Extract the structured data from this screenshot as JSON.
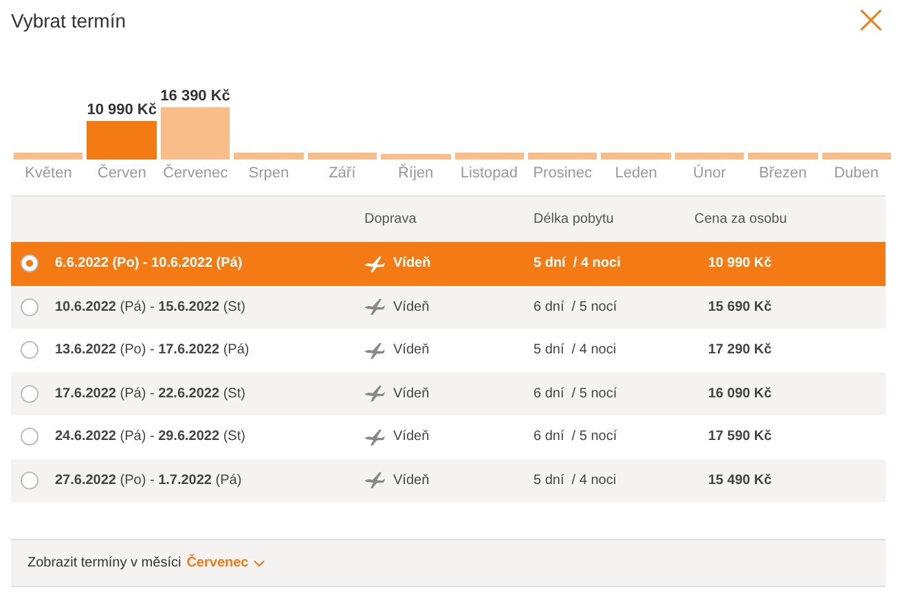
{
  "dialog": {
    "title": "Vybrat termín",
    "close": "×"
  },
  "months": [
    {
      "name": "Květen",
      "selected": false
    },
    {
      "name": "Červen",
      "selected": true,
      "price": "10 990 Kč"
    },
    {
      "name": "Červenec",
      "selected": false,
      "price": "16 390 Kč"
    },
    {
      "name": "Srpen",
      "selected": false
    },
    {
      "name": "Září",
      "selected": false
    },
    {
      "name": "Říjen",
      "selected": false
    },
    {
      "name": "Listopad",
      "selected": false
    },
    {
      "name": "Prosinec",
      "selected": false
    },
    {
      "name": "Leden",
      "selected": false
    },
    {
      "name": "Únor",
      "selected": false
    },
    {
      "name": "Březen",
      "selected": false
    },
    {
      "name": "Duben",
      "selected": false
    }
  ],
  "table": {
    "columns": [
      "Doprava",
      "Délka pobytu",
      "Cena za osobu"
    ],
    "rows": [
      {
        "dates": "6.6.2022 (Po) - 10.6.2022 (Pá)",
        "transport": "Vídeň",
        "stay": "5 dní  / 4 noci",
        "price": "10 990 Kč",
        "selected": true
      },
      {
        "dates": "**10.6.2022** (Pá) - **15.6.2022** (St)",
        "transport": "Vídeň",
        "stay": "6 dní  / 5 nocí",
        "price": "15 690 Kč",
        "selected": false
      },
      {
        "dates": "**13.6.2022** (Po) - **17.6.2022** (Pá)",
        "transport": "Vídeň",
        "stay": "5 dní  / 4 noci",
        "price": "17 290 Kč",
        "selected": false
      },
      {
        "dates": "**17.6.2022** (Pá) - **22.6.2022** (St)",
        "transport": "Vídeň",
        "stay": "6 dní  / 5 nocí",
        "price": "16 090 Kč",
        "selected": false
      },
      {
        "dates": "**24.6.2022** (Pá) - **29.6.2022** (St)",
        "transport": "Vídeň",
        "stay": "6 dní  / 5 nocí",
        "price": "17 590 Kč",
        "selected": false
      },
      {
        "dates": "**27.6.2022** (Po) - **1.7.2022** (Pá)",
        "transport": "Vídeň",
        "stay": "5 dní  / 4 noci",
        "price": "15 490 Kč",
        "selected": false
      }
    ]
  },
  "footer": {
    "text": "Zobrazit termíny v měsíci",
    "link": "Červenec"
  }
}
